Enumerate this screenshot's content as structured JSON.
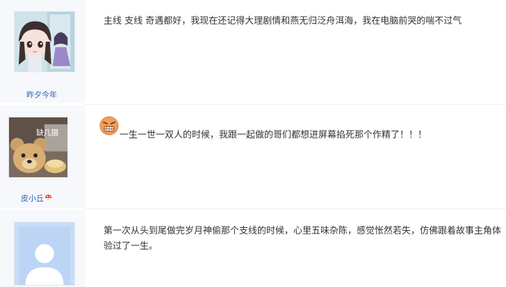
{
  "posts": [
    {
      "username": "昨夕今年",
      "avatar_icon": "anime-girl-avatar",
      "content": "主线 支线 奇遇都好，我现在还记得大理剧情和燕无归泛舟洱海，我在电脑前哭的喘不过气"
    },
    {
      "username": "皮小丘",
      "avatar_icon": "teddy-bear-avatar",
      "avatar_caption": "缺几摄",
      "badge_icon": "mushroom-icon",
      "emoji_icon": "angry-face-emoji",
      "content": "一生一世一双人的时候，我跟一起做的哥们都想进屏幕掐死那个作精了！！！"
    },
    {
      "username": "",
      "avatar_icon": "default-user-avatar",
      "content": "第一次从头到尾做完岁月神偷那个支线的时候，心里五味杂陈，感觉怅然若失，仿佛跟着故事主角体验过了一生。"
    }
  ],
  "colors": {
    "username": "#2d64b3",
    "sidebar_bg": "#f6f8fb",
    "text": "#333333"
  }
}
